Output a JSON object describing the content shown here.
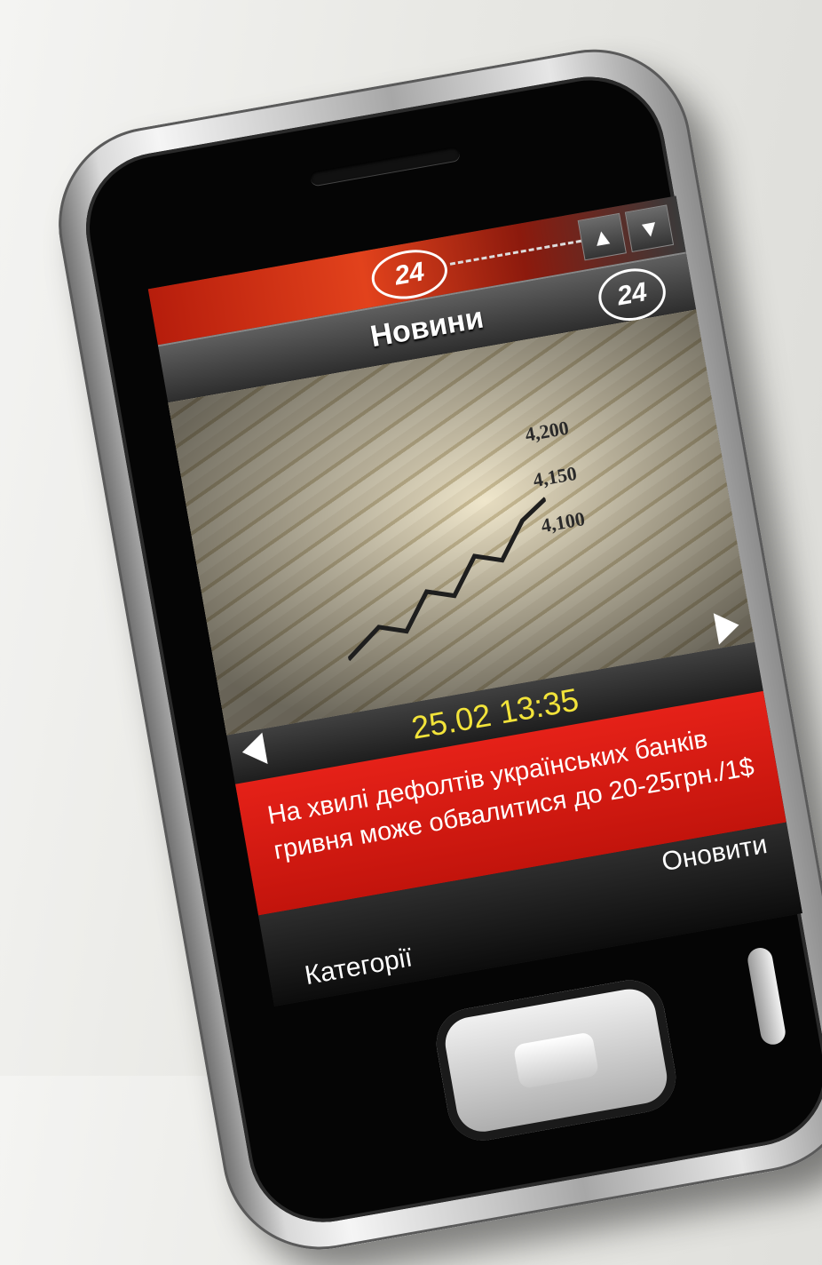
{
  "brand": {
    "logo_text": "24"
  },
  "nav": {
    "up_symbol": "▲",
    "down_symbol": "▼"
  },
  "header": {
    "title": "Новини",
    "corner_logo": "24"
  },
  "article": {
    "chart_ticks": [
      "4,200",
      "4,150",
      "4,100"
    ],
    "datetime": "25.02 13:35",
    "headline": "На хвилі дефолтів українських банків гривня може обвалитися до 20-25грн./1$"
  },
  "softkeys": {
    "right": "Оновити",
    "left": "Категорії"
  },
  "colors": {
    "accent_red": "#d91a12",
    "date_yellow": "#f2e33a"
  }
}
